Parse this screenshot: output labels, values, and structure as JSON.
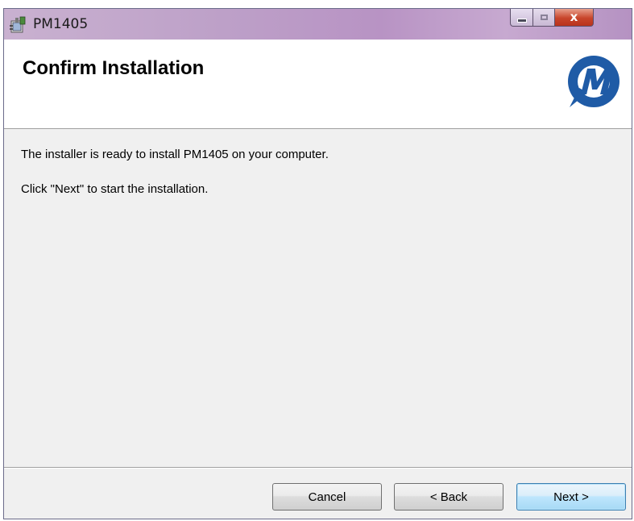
{
  "window": {
    "title": "PM1405",
    "close_glyph": "x"
  },
  "banner": {
    "title": "Confirm Installation"
  },
  "body": {
    "line1": "The installer is ready to install PM1405 on your computer.",
    "line2": "Click \"Next\" to start the installation."
  },
  "buttons": {
    "cancel": "Cancel",
    "back": "< Back",
    "next": "Next >"
  },
  "icons": {
    "app": "installer-package-icon",
    "logo": "m-logo",
    "minimize": "minimize-icon",
    "maximize": "maximize-icon",
    "close": "close-icon"
  },
  "colors": {
    "titlebar": "#bda0c8",
    "logo_blue": "#1f5ba6",
    "close_red": "#c8452b",
    "next_border": "#3c7fb1"
  }
}
